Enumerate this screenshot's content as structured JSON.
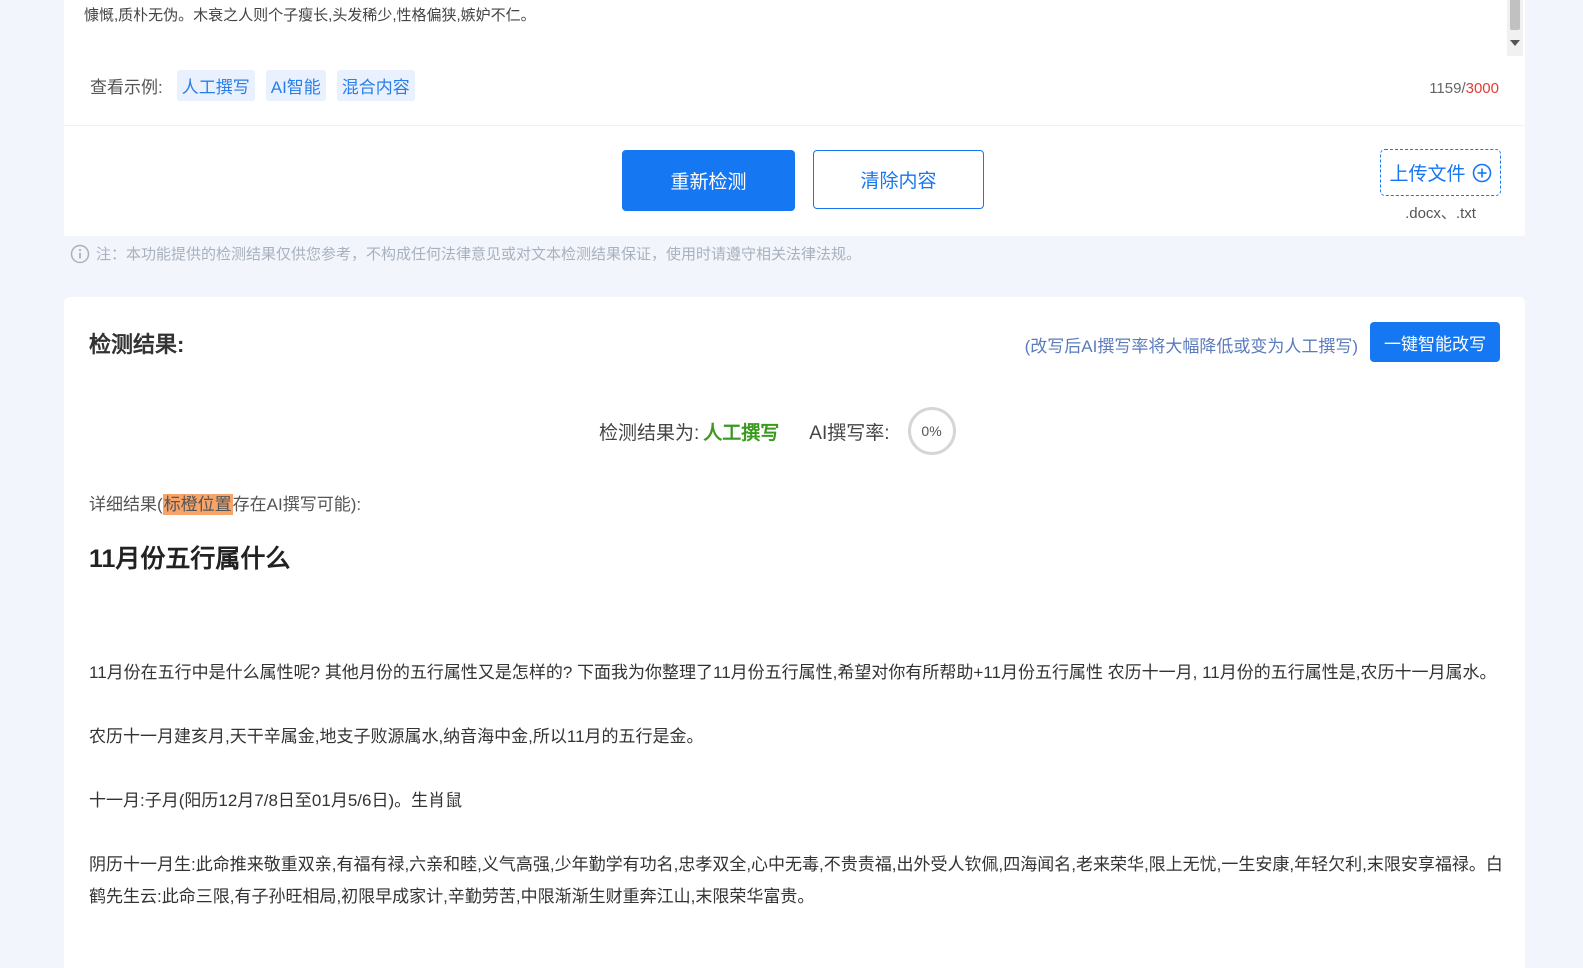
{
  "input": {
    "text_excerpt": "慷慨,质朴无伪。木衰之人则个子瘦长,头发稀少,性格偏狭,嫉妒不仁。",
    "examples_label": "查看示例:",
    "example_tags": [
      "人工撰写",
      "AI智能",
      "混合内容"
    ],
    "char_count": "1159/",
    "char_max": "3000"
  },
  "actions": {
    "recheck_label": "重新检测",
    "clear_label": "清除内容",
    "upload_label": "上传文件",
    "upload_hint": ".docx、.txt"
  },
  "note": "注：本功能提供的检测结果仅供您参考，不构成任何法律意见或对文本检测结果保证，使用时请遵守相关法律法规。",
  "result": {
    "title": "检测结果:",
    "rewrite_hint": "(改写后AI撰写率将大幅降低或变为人工撰写)",
    "rewrite_button": "一键智能改写",
    "summary_label": "检测结果为:",
    "summary_value": "人工撰写",
    "ai_rate_label": "AI撰写率:",
    "ai_rate_value": "0%",
    "detail_prefix": "详细结果(",
    "detail_highlight": "标橙位置",
    "detail_suffix": "存在AI撰写可能):",
    "article_title": "11月份五行属什么",
    "paragraphs": [
      "11月份在五行中是什么属性呢? 其他月份的五行属性又是怎样的? 下面我为你整理了11月份五行属性,希望对你有所帮助+11月份五行属性 农历十一月, 11月份的五行属性是,农历十一月属水。",
      "农历十一月建亥月,天干辛属金,地支子败源属水,纳音海中金,所以11月的五行是金。",
      "十一月:子月(阳历12月7/8日至01月5/6日)。生肖鼠",
      "阴历十一月生:此命推来敬重双亲,有福有禄,六亲和睦,义气高强,少年勤学有功名,忠孝双全,心中无毒,不贵责福,出外受人钦佩,四海闻名,老来荣华,限上无忧,一生安康,年轻欠利,末限安享福禄。白鹤先生云:此命三限,有子孙旺相局,初限早成家计,辛勤劳苦,中限渐渐生财重奔江山,末限荣华富贵。"
    ]
  },
  "colors": {
    "primary": "#1677f2",
    "human_result": "#3a9a1e",
    "highlight": "#f7a46b",
    "limit": "#e53935"
  }
}
